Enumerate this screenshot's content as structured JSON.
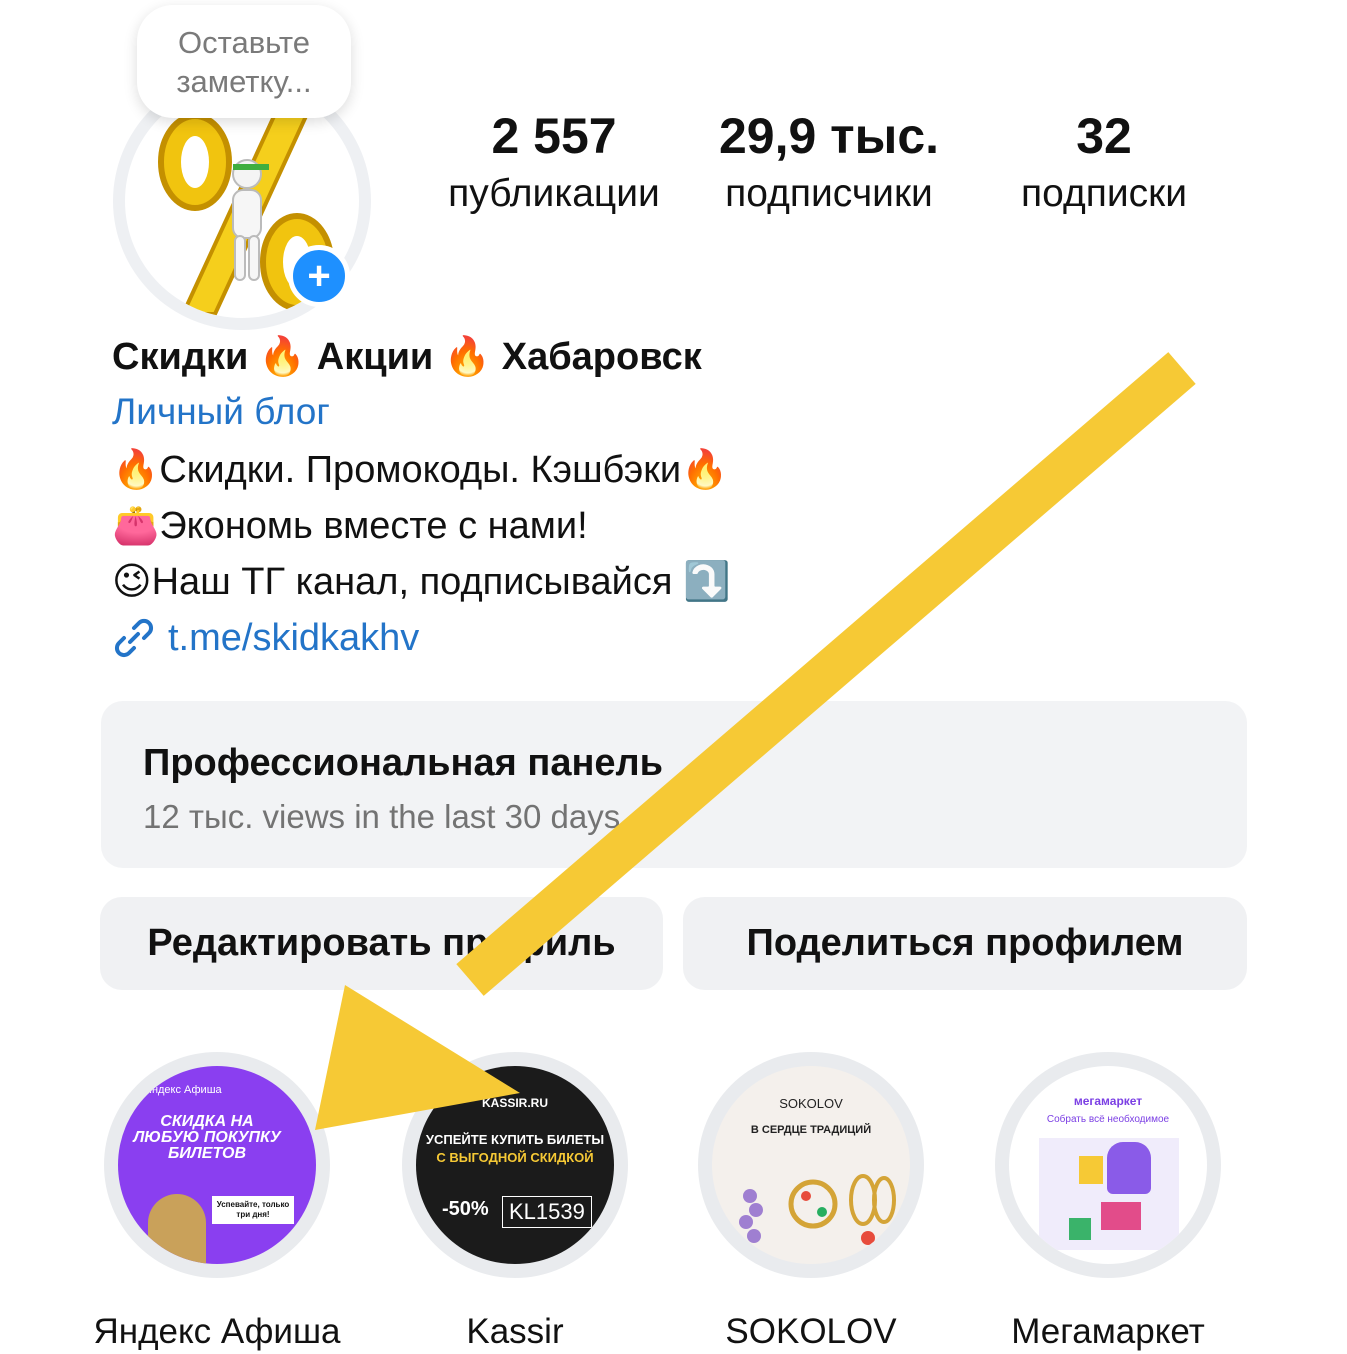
{
  "note": {
    "text": "Оставьте заметку..."
  },
  "stats": [
    {
      "value": "2 557",
      "label": "публикации"
    },
    {
      "value": "29,9 тыс.",
      "label": "подписчики"
    },
    {
      "value": "32",
      "label": "подписки"
    }
  ],
  "profile": {
    "name": "Скидки 🔥 Акции 🔥 Хабаровск",
    "category": "Личный блог",
    "bio": [
      "🔥Скидки. Промокоды. Кэшбэки🔥",
      "👛Экономь вместе с нами!",
      "😉Наш ТГ канал, подписывайся ⤵️"
    ],
    "link": "t.me/skidkakhv"
  },
  "pro_panel": {
    "title": "Профессиональная панель",
    "subtitle": "12 тыс. views in the last 30 days"
  },
  "buttons": {
    "edit": "Редактировать профиль",
    "share": "Поделиться профилем"
  },
  "highlights": [
    {
      "label": "Яндекс Афиша",
      "cover_brand": "Яндекс Афиша",
      "cover_text": "СКИДКА НА ЛЮБУЮ ПОКУПКУ БИЛЕТОВ",
      "cover_note": "Успевайте, только три дня!",
      "color": "#8a3ff0"
    },
    {
      "label": "Kassir",
      "cover_brand": "KASSIR.RU",
      "cover_text": "УСПЕЙТЕ КУПИТЬ БИЛЕТЫ",
      "cover_text2": "С ВЫГОДНОЙ СКИДКОЙ",
      "cover_discount": "-50%",
      "cover_code": "KL1539",
      "color": "#1b1b1b"
    },
    {
      "label": "SOKOLOV",
      "cover_brand": "SOKOLOV",
      "cover_text": "В СЕРДЦЕ ТРАДИЦИЙ",
      "color": "#f4f0ec"
    },
    {
      "label": "Мегамаркет",
      "cover_brand": "мегамаркет",
      "cover_text": "Собрать всё необходимое",
      "color": "#ffffff"
    }
  ],
  "colors": {
    "link_blue": "#2374c8",
    "plus_blue": "#1e90ff",
    "arrow_yellow": "#f6c935",
    "panel_gray": "#f2f3f5"
  }
}
